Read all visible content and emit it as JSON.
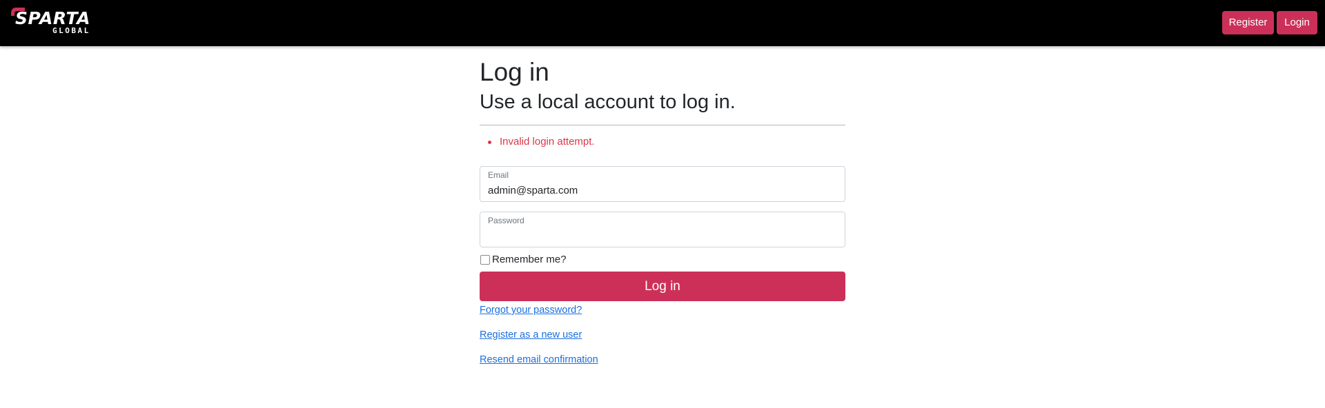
{
  "brand": {
    "name": "SPARTA",
    "sub": "GLOBAL",
    "accent_color": "#cc3059"
  },
  "nav": {
    "register_label": "Register",
    "login_label": "Login"
  },
  "page": {
    "title": "Log in",
    "subtitle": "Use a local account to log in."
  },
  "errors": [
    "Invalid login attempt."
  ],
  "form": {
    "email": {
      "label": "Email",
      "value": "admin@sparta.com"
    },
    "password": {
      "label": "Password",
      "value": ""
    },
    "remember_label": "Remember me?",
    "remember_checked": false,
    "submit_label": "Log in"
  },
  "links": {
    "forgot": "Forgot your password?",
    "register": "Register as a new user",
    "resend": "Resend email confirmation"
  }
}
